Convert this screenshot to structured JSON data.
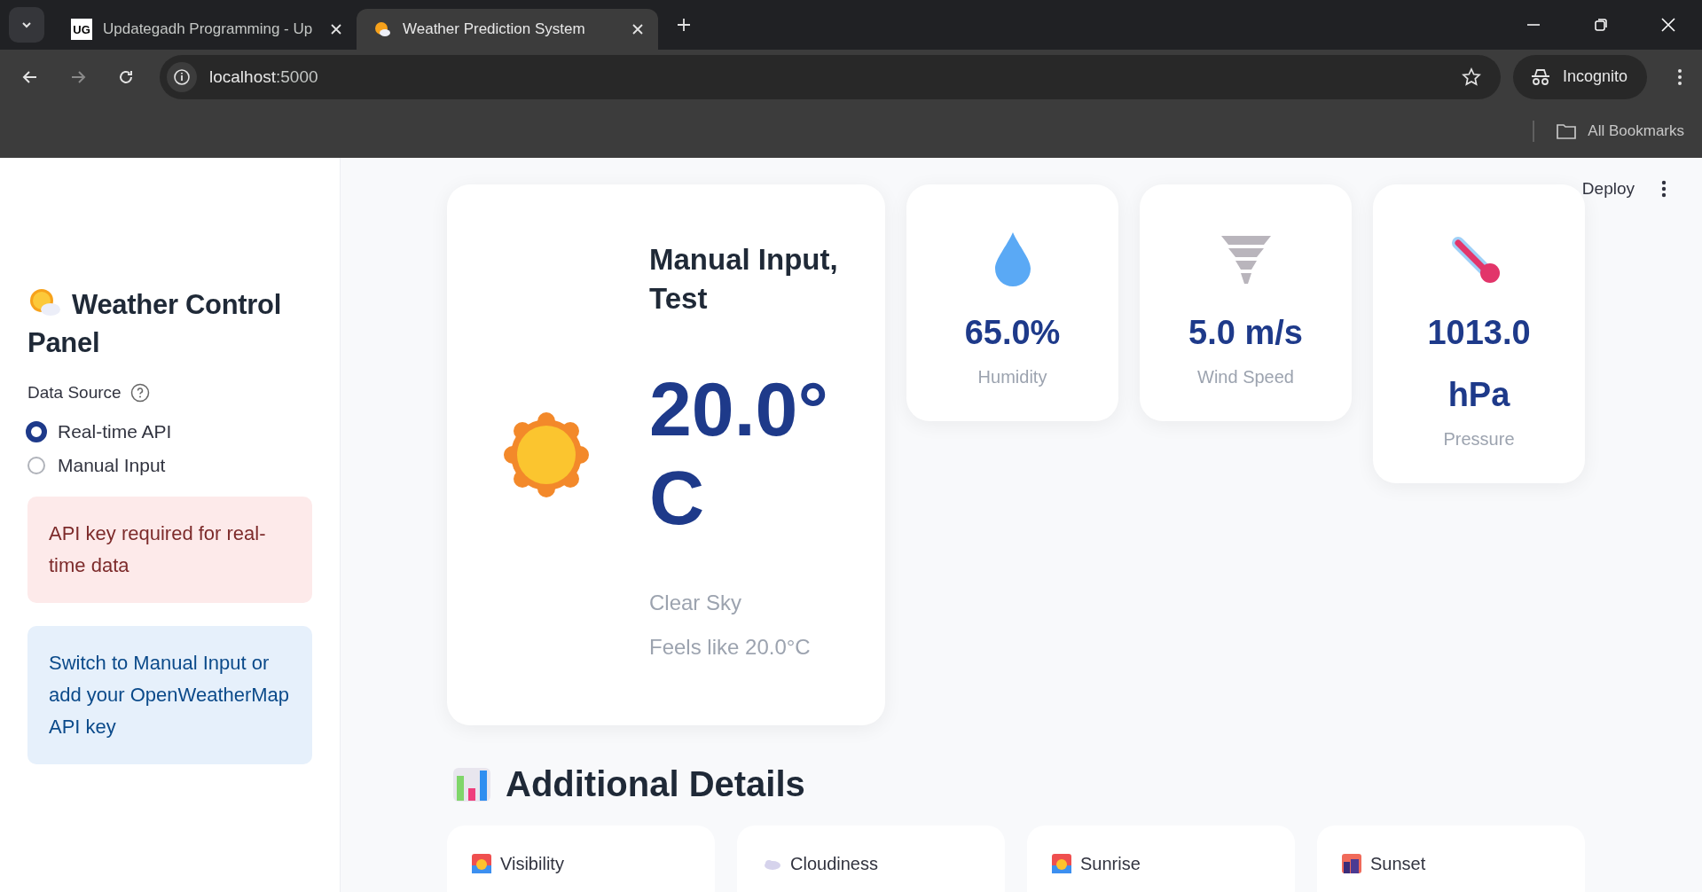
{
  "browser": {
    "tabs": [
      {
        "title": "Updategadh Programming - Up",
        "kind": "logo",
        "logo_text": "UG",
        "selected": false
      },
      {
        "title": "Weather Prediction System",
        "kind": "sun-cloud",
        "selected": true
      }
    ],
    "url_host": "localhost",
    "url_port": ":5000",
    "profile": "Incognito",
    "bookmarks": "All Bookmarks"
  },
  "header": {
    "deploy": "Deploy"
  },
  "sidebar": {
    "title": "Weather Control Panel",
    "field_label": "Data Source",
    "options": [
      {
        "label": "Real-time API",
        "selected": true
      },
      {
        "label": "Manual Input",
        "selected": false
      }
    ],
    "alerts": [
      {
        "kind": "error",
        "text": "API key required for real-time data"
      },
      {
        "kind": "info",
        "text": "Switch to Manual Input or add your OpenWeatherMap API key"
      }
    ]
  },
  "weather": {
    "location": "Manual Input, Test",
    "temperature": "20.0°C",
    "condition": "Clear Sky",
    "feels_like": "Feels like 20.0°C"
  },
  "metrics": [
    {
      "kind": "humidity",
      "value": "65.0%",
      "label": "Humidity"
    },
    {
      "kind": "wind",
      "value": "5.0 m/s",
      "label": "Wind Speed"
    },
    {
      "kind": "pressure",
      "value": "1013.0 hPa",
      "label": "Pressure"
    }
  ],
  "details": {
    "heading": "Additional Details",
    "cards": [
      {
        "kind": "sunrise",
        "label": "Visibility"
      },
      {
        "kind": "cloud",
        "label": "Cloudiness"
      },
      {
        "kind": "sunrise",
        "label": "Sunrise"
      },
      {
        "kind": "city",
        "label": "Sunset"
      }
    ]
  }
}
